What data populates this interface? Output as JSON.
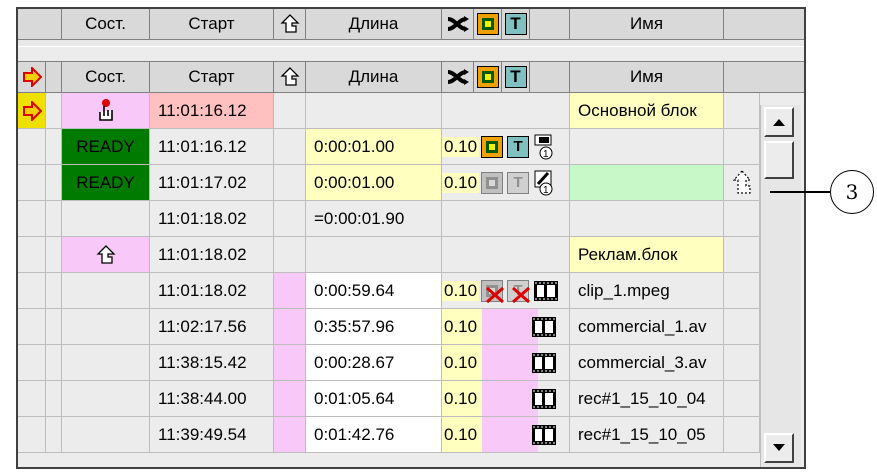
{
  "header": {
    "state": "Сост.",
    "start": "Старт",
    "duration": "Длина",
    "name": "Имя"
  },
  "rows": [
    {
      "state": "",
      "start": "11:01:16.12",
      "duration": "",
      "level": "",
      "name": "Основной блок"
    },
    {
      "state": "READY",
      "start": "11:01:16.12",
      "duration": "0:00:01.00",
      "level": "0.10",
      "name": ""
    },
    {
      "state": "READY",
      "start": "11:01:17.02",
      "duration": "0:00:01.00",
      "level": "0.10",
      "name": ""
    },
    {
      "state": "",
      "start": "11:01:18.02",
      "duration": "=0:00:01.90",
      "level": "",
      "name": ""
    },
    {
      "state": "",
      "start": "11:01:18.02",
      "duration": "",
      "level": "",
      "name": "Реклам.блок"
    },
    {
      "state": "",
      "start": "11:01:18.02",
      "duration": "0:00:59.64",
      "level": "0.10",
      "name": "clip_1.mpeg"
    },
    {
      "state": "",
      "start": "11:02:17.56",
      "duration": "0:35:57.96",
      "level": "0.10",
      "name": "commercial_1.av"
    },
    {
      "state": "",
      "start": "11:38:15.42",
      "duration": "0:00:28.67",
      "level": "0.10",
      "name": "commercial_3.av"
    },
    {
      "state": "",
      "start": "11:38:44.00",
      "duration": "0:01:05.64",
      "level": "0.10",
      "name": "rec#1_15_10_04"
    },
    {
      "state": "",
      "start": "11:39:49.54",
      "duration": "0:01:42.76",
      "level": "0.10",
      "name": "rec#1_15_10_05"
    }
  ],
  "callout": {
    "number": "3"
  },
  "icons": {
    "arrow": "red-yellow-arrow-icon",
    "return": "return-arrow-icon",
    "shuffle": "shuffle-icon",
    "overlay": "overlay-icon",
    "title": "title-t-icon",
    "film": "film-icon"
  },
  "colors": {
    "ready": "#007a00",
    "pink": "#f8c8f8",
    "yellow": "#ffffc0",
    "green": "#c8f8c8",
    "salmon": "#ffc0c0"
  },
  "title_letter": "T",
  "sub_number": "1"
}
